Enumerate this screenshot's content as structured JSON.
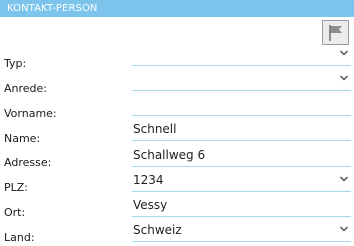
{
  "header": {
    "title": "KONTAKT-PERSON"
  },
  "toolbar": {
    "flag_icon": "flag-icon"
  },
  "form": {
    "typ": {
      "label": "Typ:",
      "value": ""
    },
    "anrede": {
      "label": "Anrede:",
      "value": ""
    },
    "vorname": {
      "label": "Vorname:",
      "value": ""
    },
    "name": {
      "label": "Name:",
      "value": "Schnell"
    },
    "adresse": {
      "label": "Adresse:",
      "value": "Schallweg 6"
    },
    "plz": {
      "label": "PLZ:",
      "value": "1234"
    },
    "ort": {
      "label": "Ort:",
      "value": "Vessy"
    },
    "land": {
      "label": "Land:",
      "value": "Schweiz"
    }
  },
  "colors": {
    "header_bg": "#7cc4ec",
    "field_underline": "#a7d7ef"
  }
}
